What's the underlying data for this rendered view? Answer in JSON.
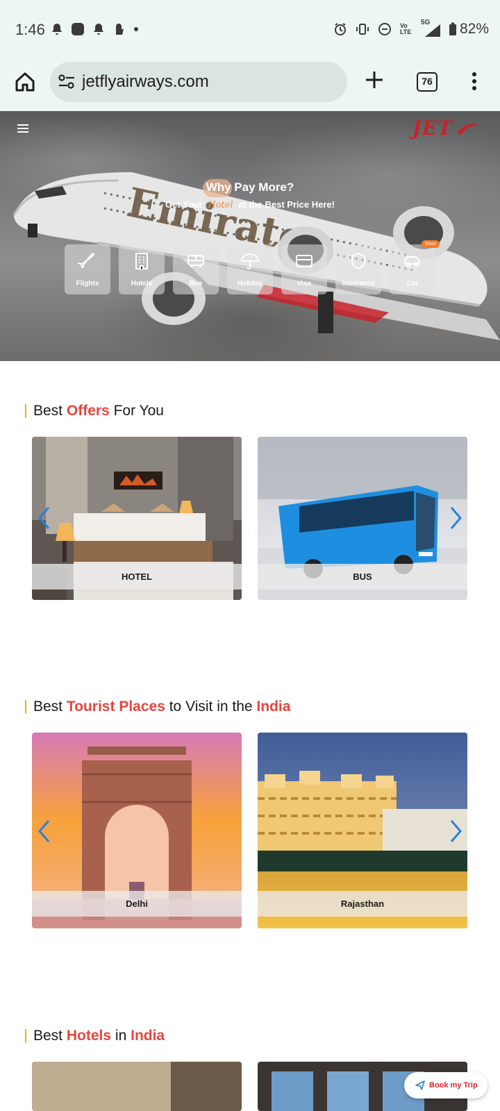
{
  "status_bar": {
    "time": "1:46",
    "battery": "82%",
    "network": "5G",
    "volte": "Vo LTE"
  },
  "browser": {
    "url": "jetflyairways.com",
    "tab_count": "76"
  },
  "hero": {
    "logo": "JET",
    "title": "Why Pay More?",
    "subtitle_prefix": "Get Your",
    "subtitle_script": "Hotel",
    "subtitle_suffix": "at the Best Price Here!",
    "services": [
      {
        "label": "Flights",
        "icon": "plane-icon"
      },
      {
        "label": "Hotels",
        "icon": "building-icon"
      },
      {
        "label": "Bus",
        "icon": "bus-icon"
      },
      {
        "label": "Holiday",
        "icon": "umbrella-icon"
      },
      {
        "label": "Visa",
        "icon": "card-icon"
      },
      {
        "label": "Insurance",
        "icon": "shield-icon"
      },
      {
        "label": "Car",
        "icon": "car-icon",
        "badge": "Soon"
      }
    ]
  },
  "offers": {
    "title_pre": "Best",
    "title_hl": "Offers",
    "title_post": "For You",
    "cards": [
      "HOTEL",
      "BUS"
    ]
  },
  "tourist": {
    "title_pre": "Best",
    "title_hl": "Tourist Places",
    "title_mid": "to Visit in the",
    "title_hl2": "India",
    "cards": [
      "Delhi",
      "Rajasthan"
    ]
  },
  "hotels": {
    "title_pre": "Best",
    "title_hl": "Hotels",
    "title_mid": "in",
    "title_hl2": "India"
  },
  "floating": {
    "book_label": "Book my Trip"
  },
  "colors": {
    "accent_red": "#e8453c",
    "brand_red": "#c8222a",
    "badge_orange": "#f07a2a",
    "title_bar_yellow": "#f5b400",
    "carousel_arrow_blue": "#2d7fd8"
  }
}
